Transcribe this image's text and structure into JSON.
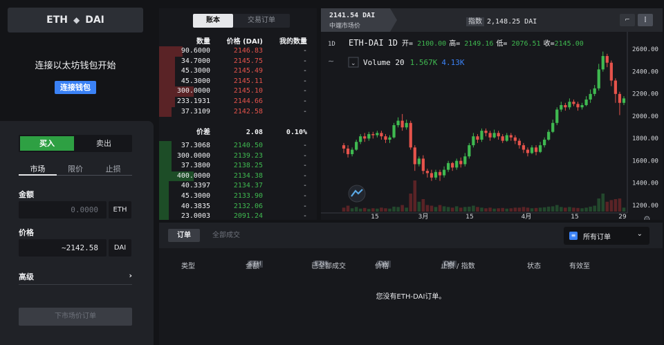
{
  "pair": {
    "base": "ETH",
    "quote": "DAI"
  },
  "wallet": {
    "message": "连接以太坊钱包开始",
    "button": "连接钱包"
  },
  "trade": {
    "buy": "买入",
    "sell": "卖出",
    "tabs": [
      "市场",
      "限价",
      "止损"
    ],
    "amount_label": "金额",
    "amount_placeholder": "0.0000",
    "amount_unit": "ETH",
    "price_label": "价格",
    "price_value": "~2142.58",
    "price_unit": "DAI",
    "advanced": "高级",
    "advanced_chevron": "›",
    "submit": "下市场价订单"
  },
  "book": {
    "tabs": [
      "账本",
      "交易订单"
    ],
    "headers": [
      "数量",
      "价格 (DAI)",
      "我的数量"
    ],
    "asks": [
      {
        "qty": "90.6000",
        "price": "2146.83",
        "mine": "-",
        "depth": 0.15
      },
      {
        "qty": "34.7000",
        "price": "2145.75",
        "mine": "-",
        "depth": 0.1
      },
      {
        "qty": "45.3000",
        "price": "2145.49",
        "mine": "-",
        "depth": 0.1
      },
      {
        "qty": "45.3000",
        "price": "2145.11",
        "mine": "-",
        "depth": 0.1
      },
      {
        "qty": "300.0000",
        "price": "2145.10",
        "mine": "-",
        "depth": 0.22
      },
      {
        "qty": "233.1931",
        "price": "2144.66",
        "mine": "-",
        "depth": 0.1
      },
      {
        "qty": "37.3109",
        "price": "2142.58",
        "mine": "-",
        "depth": 0.08
      }
    ],
    "spread": {
      "label": "价差",
      "value": "2.08",
      "pct": "0.10%"
    },
    "bids": [
      {
        "qty": "37.3068",
        "price": "2140.50",
        "mine": "-",
        "depth": 0.08
      },
      {
        "qty": "300.0000",
        "price": "2139.23",
        "mine": "-",
        "depth": 0.08
      },
      {
        "qty": "37.3800",
        "price": "2138.25",
        "mine": "-",
        "depth": 0.08
      },
      {
        "qty": "400.0000",
        "price": "2134.38",
        "mine": "-",
        "depth": 0.22
      },
      {
        "qty": "40.3397",
        "price": "2134.37",
        "mine": "-",
        "depth": 0.06
      },
      {
        "qty": "45.3000",
        "price": "2133.90",
        "mine": "-",
        "depth": 0.06
      },
      {
        "qty": "40.3835",
        "price": "2132.06",
        "mine": "-",
        "depth": 0.06
      },
      {
        "qty": "23.0003",
        "price": "2091.24",
        "mine": "-",
        "depth": 0.06
      }
    ]
  },
  "chart": {
    "mid_price": "2141.54 DAI",
    "mid_label": "中端市场价",
    "index_label": "指数",
    "index_value": "2,148.25 DAI",
    "interval": "1D",
    "ohlc": {
      "symbol": "ETH-DAI",
      "interval": "1D",
      "o_label": "开=",
      "o": "2100.00",
      "h_label": "高=",
      "h": "2149.16",
      "l_label": "低=",
      "l": "2076.51",
      "c_label": "收=",
      "c": "2145.00"
    },
    "volume": {
      "label": "Volume 20",
      "v1": "1.567K",
      "v2": "4.13K"
    },
    "yticks": [
      "2600.00",
      "2400.00",
      "2200.00",
      "2000.00",
      "1800.00",
      "1600.00",
      "1400.00",
      "1200.00"
    ],
    "xticks": [
      "15",
      "3月",
      "15",
      "4月",
      "15",
      "29"
    ]
  },
  "chart_data": {
    "type": "candlestick",
    "yrange": [
      1150,
      2700
    ],
    "candles": [
      [
        1720,
        1690,
        1650,
        1740
      ],
      [
        1690,
        1640,
        1610,
        1720
      ],
      [
        1640,
        1680,
        1620,
        1700
      ],
      [
        1680,
        1750,
        1670,
        1770
      ],
      [
        1750,
        1800,
        1730,
        1820
      ],
      [
        1800,
        1780,
        1750,
        1830
      ],
      [
        1780,
        1820,
        1760,
        1840
      ],
      [
        1820,
        1810,
        1780,
        1840
      ],
      [
        1810,
        1830,
        1790,
        1850
      ],
      [
        1830,
        1800,
        1770,
        1850
      ],
      [
        1800,
        1770,
        1740,
        1820
      ],
      [
        1770,
        1790,
        1740,
        1810
      ],
      [
        1790,
        1900,
        1780,
        1920
      ],
      [
        1900,
        1940,
        1880,
        1970
      ],
      [
        1940,
        1880,
        1850,
        2000
      ],
      [
        1880,
        1920,
        1860,
        1950
      ],
      [
        1920,
        1700,
        1680,
        1940
      ],
      [
        1700,
        1550,
        1490,
        1720
      ],
      [
        1550,
        1600,
        1530,
        1620
      ],
      [
        1600,
        1490,
        1460,
        1630
      ],
      [
        1490,
        1470,
        1430,
        1510
      ],
      [
        1470,
        1430,
        1400,
        1500
      ],
      [
        1430,
        1480,
        1410,
        1500
      ],
      [
        1480,
        1450,
        1400,
        1500
      ],
      [
        1450,
        1500,
        1430,
        1530
      ],
      [
        1500,
        1560,
        1480,
        1580
      ],
      [
        1560,
        1520,
        1490,
        1570
      ],
      [
        1520,
        1580,
        1500,
        1600
      ],
      [
        1580,
        1550,
        1520,
        1610
      ],
      [
        1550,
        1620,
        1530,
        1650
      ],
      [
        1620,
        1720,
        1600,
        1740
      ],
      [
        1720,
        1800,
        1700,
        1830
      ],
      [
        1800,
        1770,
        1740,
        1820
      ],
      [
        1770,
        1850,
        1750,
        1870
      ],
      [
        1850,
        1830,
        1800,
        1870
      ],
      [
        1830,
        1790,
        1760,
        1850
      ],
      [
        1790,
        1830,
        1780,
        1860
      ],
      [
        1830,
        1800,
        1770,
        1850
      ],
      [
        1800,
        1760,
        1740,
        1820
      ],
      [
        1760,
        1810,
        1750,
        1830
      ],
      [
        1810,
        1790,
        1760,
        1830
      ],
      [
        1790,
        1760,
        1730,
        1810
      ],
      [
        1760,
        1720,
        1690,
        1780
      ],
      [
        1720,
        1680,
        1650,
        1740
      ],
      [
        1680,
        1650,
        1620,
        1700
      ],
      [
        1650,
        1700,
        1640,
        1720
      ],
      [
        1700,
        1660,
        1630,
        1720
      ],
      [
        1660,
        1720,
        1650,
        1750
      ],
      [
        1720,
        1770,
        1700,
        1790
      ],
      [
        1770,
        1840,
        1760,
        1860
      ],
      [
        1840,
        1920,
        1830,
        1950
      ],
      [
        1920,
        2040,
        1900,
        2060
      ],
      [
        2040,
        2080,
        2020,
        2110
      ],
      [
        2080,
        2060,
        2030,
        2100
      ],
      [
        2060,
        2110,
        2040,
        2140
      ],
      [
        2110,
        2090,
        2070,
        2130
      ],
      [
        2090,
        2060,
        2030,
        2110
      ],
      [
        2060,
        2080,
        2040,
        2100
      ],
      [
        2080,
        2130,
        2070,
        2160
      ],
      [
        2130,
        2180,
        2100,
        2220
      ],
      [
        2180,
        2230,
        2160,
        2260
      ],
      [
        2230,
        2400,
        2210,
        2450
      ],
      [
        2400,
        2520,
        2380,
        2560
      ],
      [
        2520,
        2460,
        2420,
        2540
      ],
      [
        2460,
        2300,
        2250,
        2480
      ],
      [
        2300,
        2180,
        2100,
        2320
      ],
      [
        2180,
        2100,
        1990,
        2200
      ],
      [
        2100,
        2140,
        2080,
        2160
      ]
    ],
    "volumes": [
      12,
      18,
      10,
      14,
      9,
      11,
      8,
      10,
      9,
      12,
      10,
      9,
      15,
      14,
      20,
      12,
      55,
      95,
      30,
      38,
      20,
      18,
      14,
      20,
      16,
      14,
      12,
      16,
      12,
      14,
      15,
      18,
      14,
      12,
      10,
      12,
      9,
      10,
      11,
      9,
      10,
      12,
      12,
      14,
      12,
      10,
      11,
      12,
      13,
      15,
      16,
      20,
      14,
      12,
      14,
      12,
      11,
      10,
      12,
      15,
      18,
      40,
      55,
      30,
      35,
      38,
      40,
      12
    ]
  },
  "orders": {
    "tab_open": "订单",
    "tab_fills": "全部成交",
    "filter_icon": "list-icon",
    "filter": "所有订单",
    "filter_chevron": "⌄",
    "cols": [
      {
        "label": "类型",
        "unit": ""
      },
      {
        "label": "金额",
        "unit": "ETH"
      },
      {
        "label": "已全部成交",
        "unit": "ETH"
      },
      {
        "label": "价格",
        "unit": "DAI"
      },
      {
        "label": "止损 / 指数",
        "unit": "DAI"
      },
      {
        "label": "状态",
        "unit": ""
      },
      {
        "label": "有效至",
        "unit": ""
      }
    ],
    "empty": "您没有ETH-DAI订单。"
  },
  "colors": {
    "up": "#3fb950",
    "down": "#e5534b",
    "accent": "#3b82f6"
  }
}
